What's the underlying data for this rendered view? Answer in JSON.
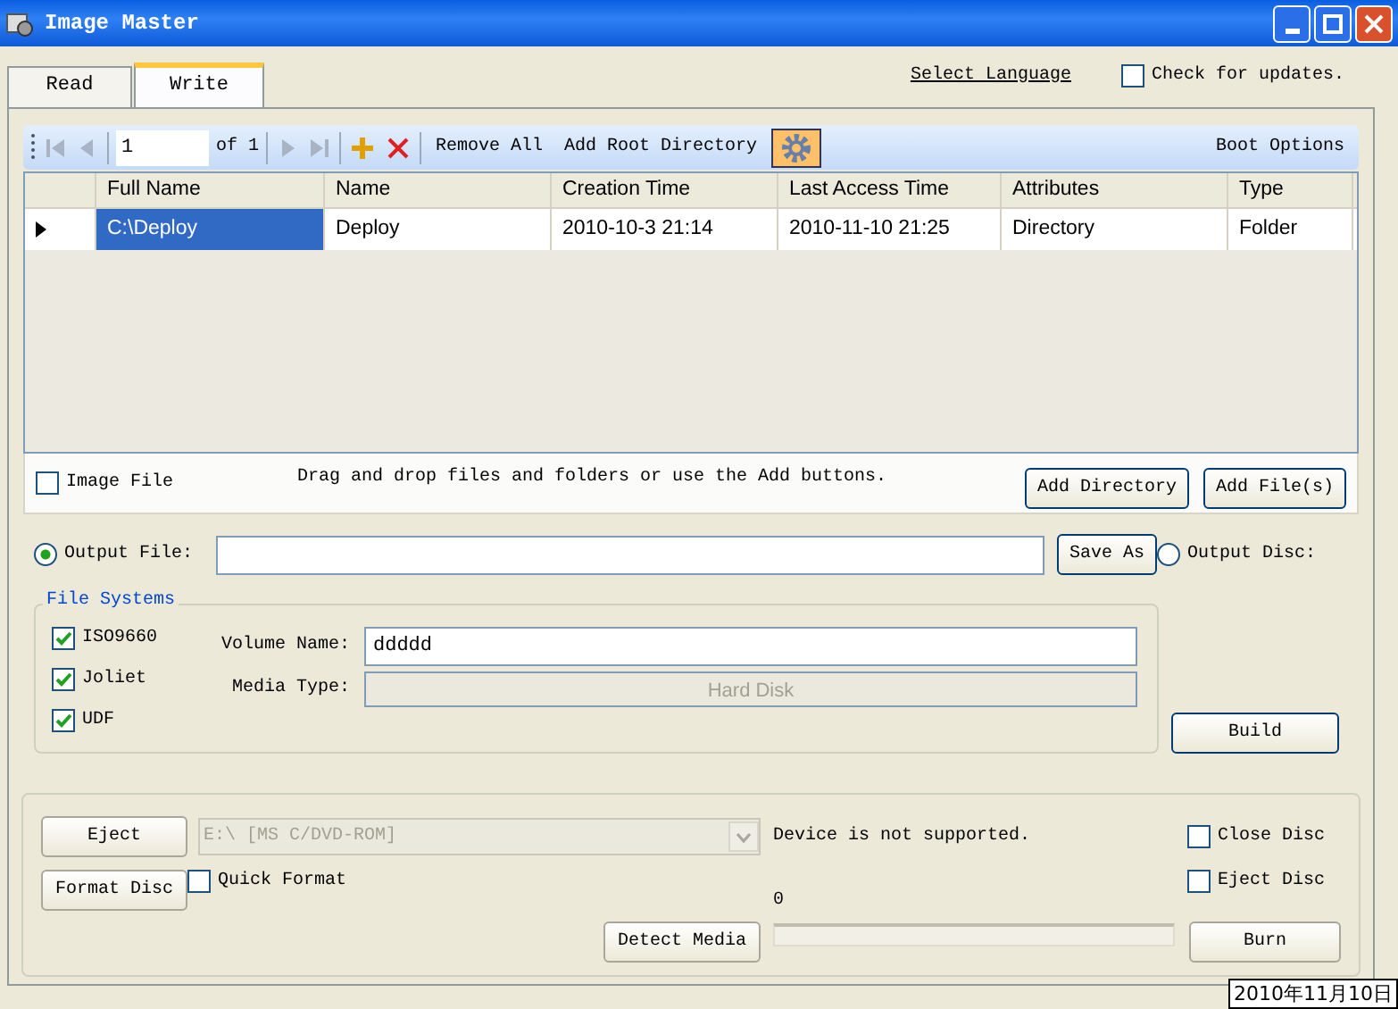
{
  "window": {
    "title": "Image Master"
  },
  "tabs": [
    {
      "label": "Read",
      "selected": false
    },
    {
      "label": "Write",
      "selected": true
    }
  ],
  "select_language": "Select Language",
  "check_updates": {
    "label": "Check for updates.",
    "checked": false
  },
  "toolbar": {
    "page": "1",
    "page_of": "of 1",
    "remove_all": "Remove All",
    "add_root_directory": "Add Root Directory",
    "boot_options": "Boot Options"
  },
  "table": {
    "columns": [
      "Full Name",
      "Name",
      "Creation Time",
      "Last Access Time",
      "Attributes",
      "Type"
    ],
    "rows": [
      {
        "cells": [
          "C:\\Deploy",
          "Deploy",
          "2010-10-3 21:14",
          "2010-11-10 21:25",
          "Directory",
          "Folder"
        ],
        "selected": true
      }
    ]
  },
  "image_file": {
    "label": "Image File",
    "checked": false
  },
  "hint": "Drag and drop files and folders or use the Add buttons.",
  "add_buttons": [
    "Add Directory",
    "Add File(s)"
  ],
  "output_file": {
    "label": "Output File:",
    "selected": true
  },
  "save_as": "Save As",
  "output_disc": {
    "label": "Output Disc:",
    "selected": false
  },
  "file_systems": {
    "title": "File Systems",
    "options": [
      {
        "label": "ISO9660",
        "checked": true
      },
      {
        "label": "Joliet",
        "checked": true
      },
      {
        "label": "UDF",
        "checked": true
      }
    ],
    "volume_name": {
      "label": "Volume Name:",
      "value": "ddddd"
    },
    "media_type": {
      "label": "Media Type:",
      "value": "Hard Disk",
      "disabled": true
    }
  },
  "build": "Build",
  "burn_panel": {
    "eject": "Eject",
    "format_disc": "Format Disc",
    "drive": {
      "value": "E:\\ [MS C/DVD-ROM]",
      "disabled": true
    },
    "status": "Device is not supported.",
    "quick_format": {
      "label": "Quick Format",
      "checked": false
    },
    "close_disc": {
      "label": "Close Disc",
      "checked": false
    },
    "eject_disc": {
      "label": "Eject Disc",
      "checked": false
    },
    "progress": {
      "reading": "0",
      "level": 0
    },
    "detect_media": "Detect Media",
    "burn": "Burn"
  },
  "clock_tooltip": "2010年11月10日"
}
